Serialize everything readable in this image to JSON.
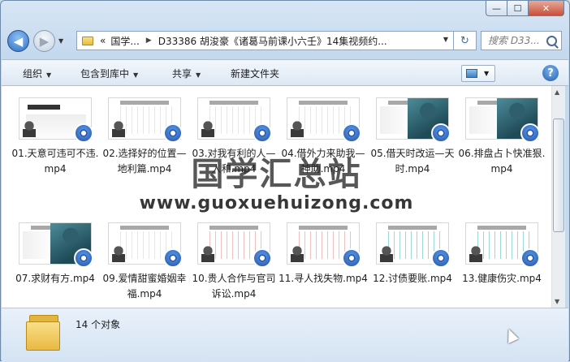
{
  "window": {
    "caption_min": "—",
    "caption_max": "☐",
    "caption_close": "✕"
  },
  "nav": {
    "back_glyph": "◀",
    "forward_glyph": "▶",
    "dropdown_glyph": "▼"
  },
  "address": {
    "prefix": "«",
    "crumbs": [
      "国学...",
      "D33386 胡浚豪《诸葛马前课小六壬》14集视频约..."
    ],
    "separator": "▶",
    "dropdown_glyph": "▼",
    "refresh_glyph": "↻"
  },
  "search": {
    "placeholder": "搜索 D33..."
  },
  "toolbar": {
    "organize": "组织",
    "include_library": "包含到库中",
    "share": "共享",
    "new_folder": "新建文件夹",
    "dropdown_glyph": "▼",
    "help": "?"
  },
  "watermark": {
    "line1": "国学汇总站",
    "line2": "www.guoxuehuizong.com"
  },
  "files": [
    {
      "name": "01.天意可违可不违.mp4",
      "style": "cover"
    },
    {
      "name": "02.选择好的位置—地利篇.mp4",
      "style": "plain"
    },
    {
      "name": "03.对我有利的人—人和.mp4",
      "style": "plain"
    },
    {
      "name": "04.借外力来助我—神助.mp4",
      "style": "plain"
    },
    {
      "name": "05.借天时改运—天时.mp4",
      "style": "portrait"
    },
    {
      "name": "06.排盘占卜快准狠.mp4",
      "style": "portrait"
    },
    {
      "name": "07.求财有方.mp4",
      "style": "portrait"
    },
    {
      "name": "09.爱情甜蜜婚姻幸福.mp4",
      "style": "plain"
    },
    {
      "name": "10.贵人合作与官司诉讼.mp4",
      "style": "highlight"
    },
    {
      "name": "11.寻人找失物.mp4",
      "style": "highlight"
    },
    {
      "name": "12.讨债要账.mp4",
      "style": "teal"
    },
    {
      "name": "13.健康伤灾.mp4",
      "style": "teal"
    }
  ],
  "details": {
    "item_count": "14 个对象"
  }
}
